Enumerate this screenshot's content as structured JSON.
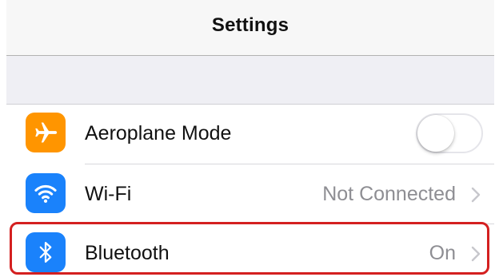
{
  "navbar": {
    "title": "Settings"
  },
  "settings": {
    "items": [
      {
        "label": "Aeroplane Mode",
        "icon": "airplane-icon",
        "icon_color": "#ff9500",
        "control": "toggle",
        "toggle_on": false
      },
      {
        "label": "Wi-Fi",
        "icon": "wifi-icon",
        "icon_color": "#1a82fb",
        "value": "Not Connected",
        "control": "disclosure"
      },
      {
        "label": "Bluetooth",
        "icon": "bluetooth-icon",
        "icon_color": "#1a82fb",
        "value": "On",
        "control": "disclosure"
      }
    ]
  },
  "annotation": {
    "highlight_color": "#d42020",
    "highlighted_item": "Bluetooth"
  },
  "colors": {
    "group_background": "#efeff4",
    "secondary_text": "#8e8e93",
    "separator": "#d8d8dc"
  }
}
